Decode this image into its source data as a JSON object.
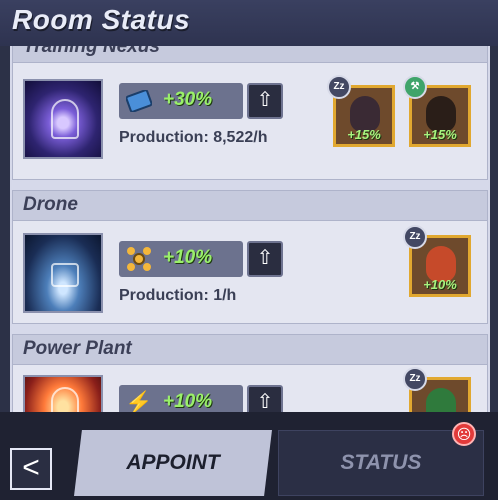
{
  "header": {
    "title": "Room Status"
  },
  "rooms": [
    {
      "name": "Training Nexus",
      "boost_icon": "chip-icon",
      "boost": "+30%",
      "production": "Production: 8,522/h",
      "heroes": [
        {
          "name": "catwoman-portrait",
          "bonus": "+15%",
          "status": "Zz"
        },
        {
          "name": "wonder-woman-portrait",
          "bonus": "+15%",
          "status": "hammer"
        }
      ]
    },
    {
      "name": "Drone",
      "boost_icon": "drone-icon",
      "boost": "+10%",
      "production": "Production: 1/h",
      "heroes": [
        {
          "name": "red-haired-hero-portrait",
          "bonus": "+10%",
          "status": "Zz"
        }
      ]
    },
    {
      "name": "Power Plant",
      "boost_icon": "lightning-icon",
      "boost": "+10%",
      "heroes": [
        {
          "name": "green-hero-portrait",
          "status": "Zz"
        }
      ]
    }
  ],
  "footer": {
    "back_label": "<",
    "tabs": [
      {
        "label": "APPOINT",
        "active": true
      },
      {
        "label": "STATUS",
        "active": false
      }
    ],
    "alert_icon": "sad-face-icon"
  },
  "colors": {
    "accent_green": "#9af06a",
    "hero_border": "#e1a830",
    "alert_red": "#e23a3a"
  }
}
